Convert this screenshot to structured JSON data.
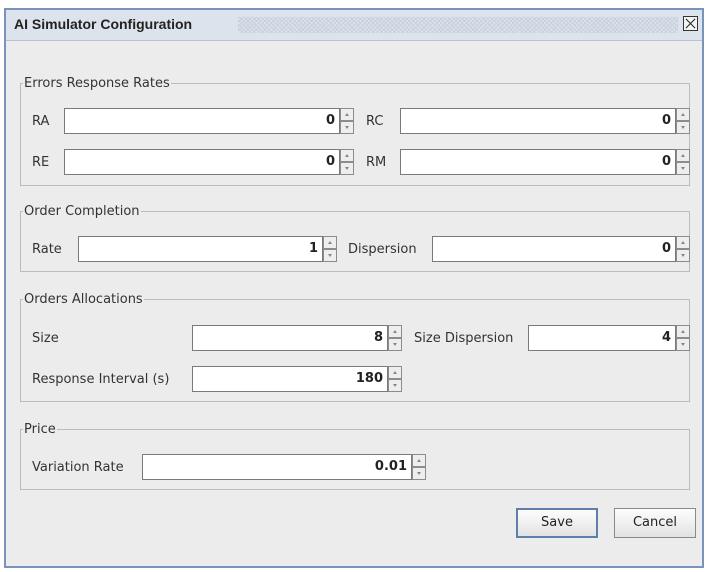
{
  "window": {
    "title": "AI Simulator Configuration"
  },
  "errors": {
    "title": "Errors Response Rates",
    "ra": {
      "label": "RA",
      "value": "0"
    },
    "rc": {
      "label": "RC",
      "value": "0"
    },
    "re": {
      "label": "RE",
      "value": "0"
    },
    "rm": {
      "label": "RM",
      "value": "0"
    }
  },
  "order_completion": {
    "title": "Order Completion",
    "rate": {
      "label": "Rate",
      "value": "1"
    },
    "dispersion": {
      "label": "Dispersion",
      "value": "0"
    }
  },
  "orders_allocations": {
    "title": "Orders Allocations",
    "size": {
      "label": "Size",
      "value": "8"
    },
    "size_dispersion": {
      "label": "Size Dispersion",
      "value": "4"
    },
    "response_interval": {
      "label": "Response Interval (s)",
      "value": "180"
    }
  },
  "price": {
    "title": "Price",
    "variation_rate": {
      "label": "Variation Rate",
      "value": "0.01"
    }
  },
  "buttons": {
    "save": "Save",
    "cancel": "Cancel"
  }
}
